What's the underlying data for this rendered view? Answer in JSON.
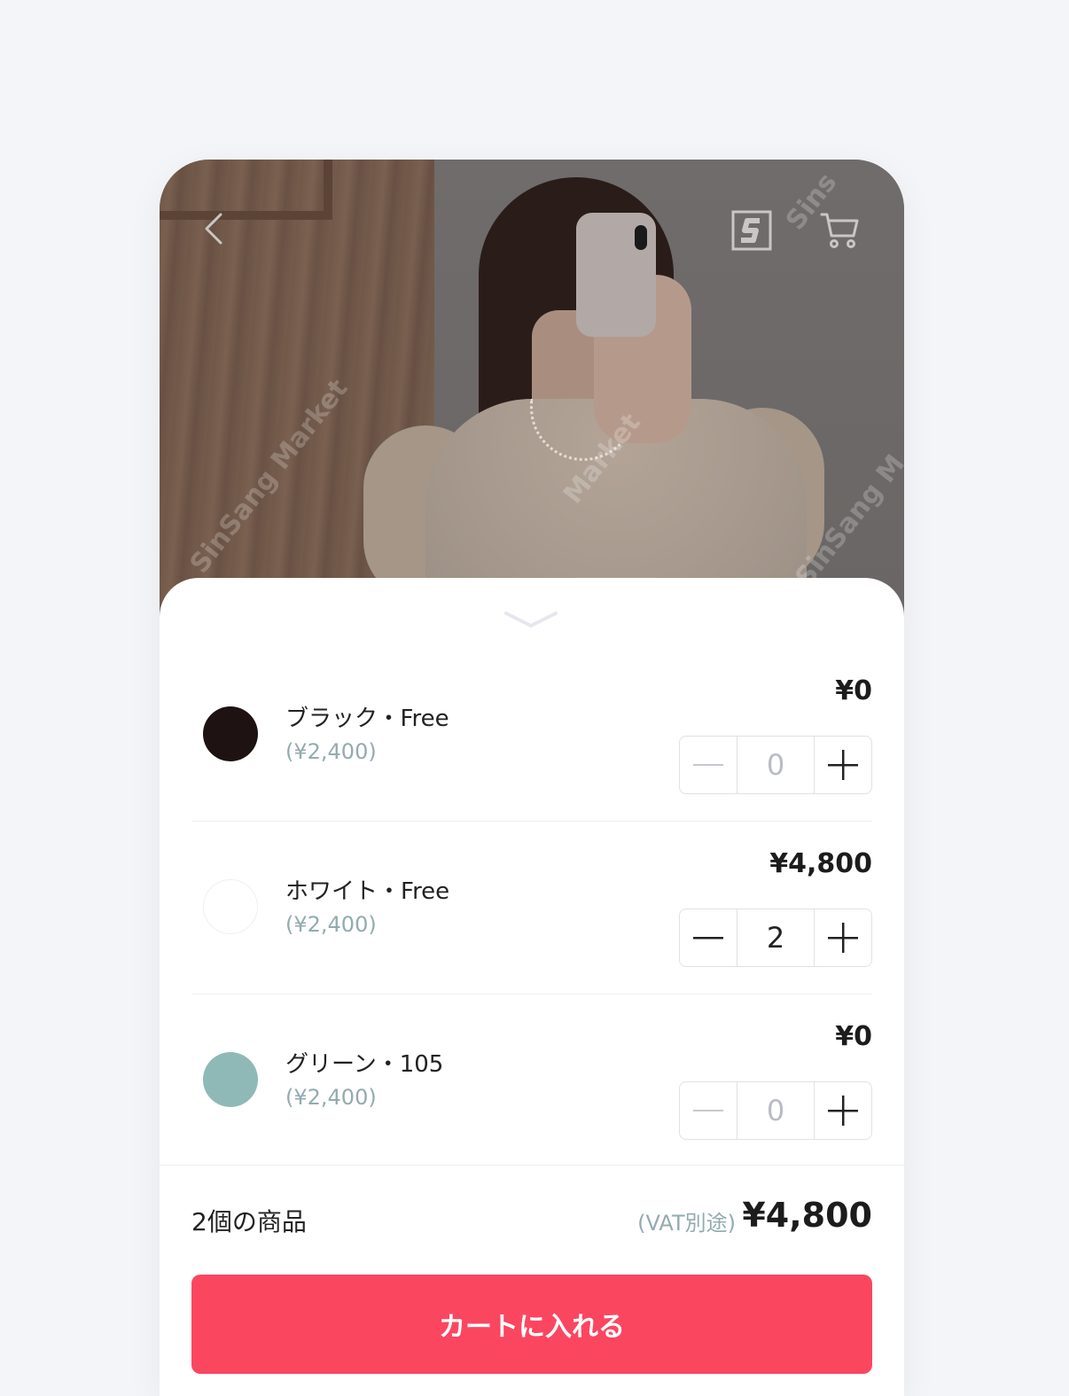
{
  "watermark": [
    "SinSang Market",
    "Market",
    "SinSang M",
    "Sins"
  ],
  "options": [
    {
      "name": "ブラック・Free",
      "unit_price": "(¥2,400)",
      "total": "¥0",
      "qty": "0",
      "swatch_color": "#1e1212",
      "minus_enabled": false
    },
    {
      "name": "ホワイト・Free",
      "unit_price": "(¥2,400)",
      "total": "¥4,800",
      "qty": "2",
      "swatch_color": "#ffffff",
      "minus_enabled": true
    },
    {
      "name": "グリーン・105",
      "unit_price": "(¥2,400)",
      "total": "¥0",
      "qty": "0",
      "swatch_color": "#8fb9b7",
      "minus_enabled": false
    }
  ],
  "summary": {
    "count_label": "2個の商品",
    "vat_label": "(VAT別途)",
    "total": "¥4,800"
  },
  "cart_button_label": "カートに入れる",
  "colors": {
    "accent": "#fb4660",
    "muted_price": "#93abb0"
  }
}
